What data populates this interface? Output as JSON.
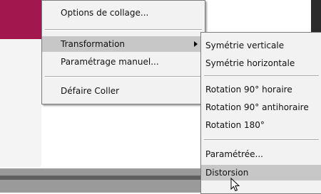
{
  "main_menu": {
    "items": [
      {
        "label": "Options de collage..."
      },
      {
        "label": "Transformation"
      },
      {
        "label": "Paramétrage manuel..."
      },
      {
        "label": "Défaire Coller"
      }
    ]
  },
  "sub_menu": {
    "items": [
      {
        "label": "Symétrie verticale"
      },
      {
        "label": "Symétrie horizontale"
      },
      {
        "label": "Rotation 90° horaire"
      },
      {
        "label": "Rotation 90° antihoraire"
      },
      {
        "label": "Rotation 180°"
      },
      {
        "label": "Paramétrée..."
      },
      {
        "label": "Distorsion"
      }
    ]
  }
}
